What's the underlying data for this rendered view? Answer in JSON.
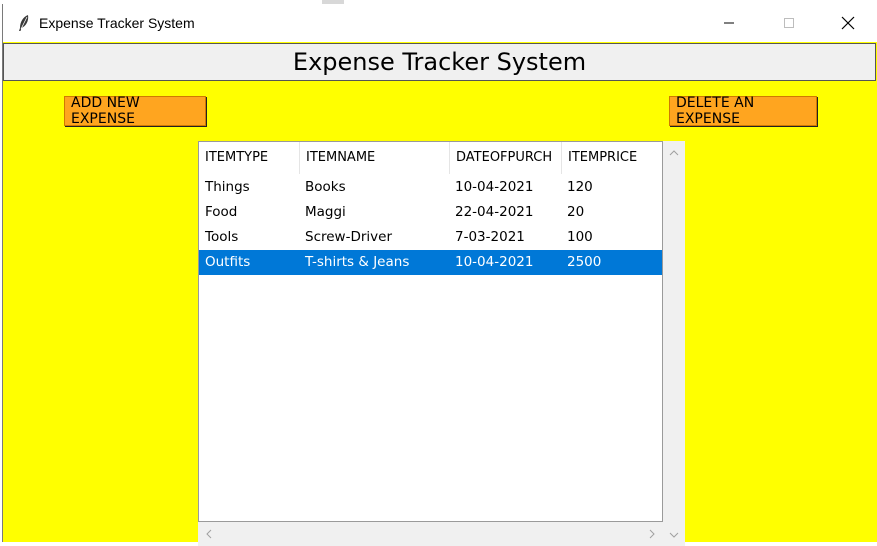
{
  "window": {
    "title": "Expense Tracker System",
    "icon": "feather-icon",
    "controls": [
      "minimize-icon",
      "maximize-icon",
      "close-icon"
    ]
  },
  "header": {
    "title": "Expense Tracker System"
  },
  "toolbar": {
    "add_label": "ADD NEW EXPENSE",
    "delete_label": "DELETE AN EXPENSE"
  },
  "table": {
    "columns": [
      "ITEMTYPE",
      "ITEMNAME",
      "DATEOFPURCH",
      "ITEMPRICE"
    ],
    "rows": [
      [
        "Things",
        "Books",
        "10-04-2021",
        "120"
      ],
      [
        "Food",
        "Maggi",
        "22-04-2021",
        "20"
      ],
      [
        "Tools",
        "Screw-Driver",
        "7-03-2021",
        "100"
      ],
      [
        "Outfits",
        "T-shirts & Jeans",
        "10-04-2021",
        "2500"
      ]
    ],
    "selected_row": 3
  },
  "colors": {
    "background": "#ffff00",
    "button": "#ffa51f",
    "selection": "#0078d7"
  }
}
